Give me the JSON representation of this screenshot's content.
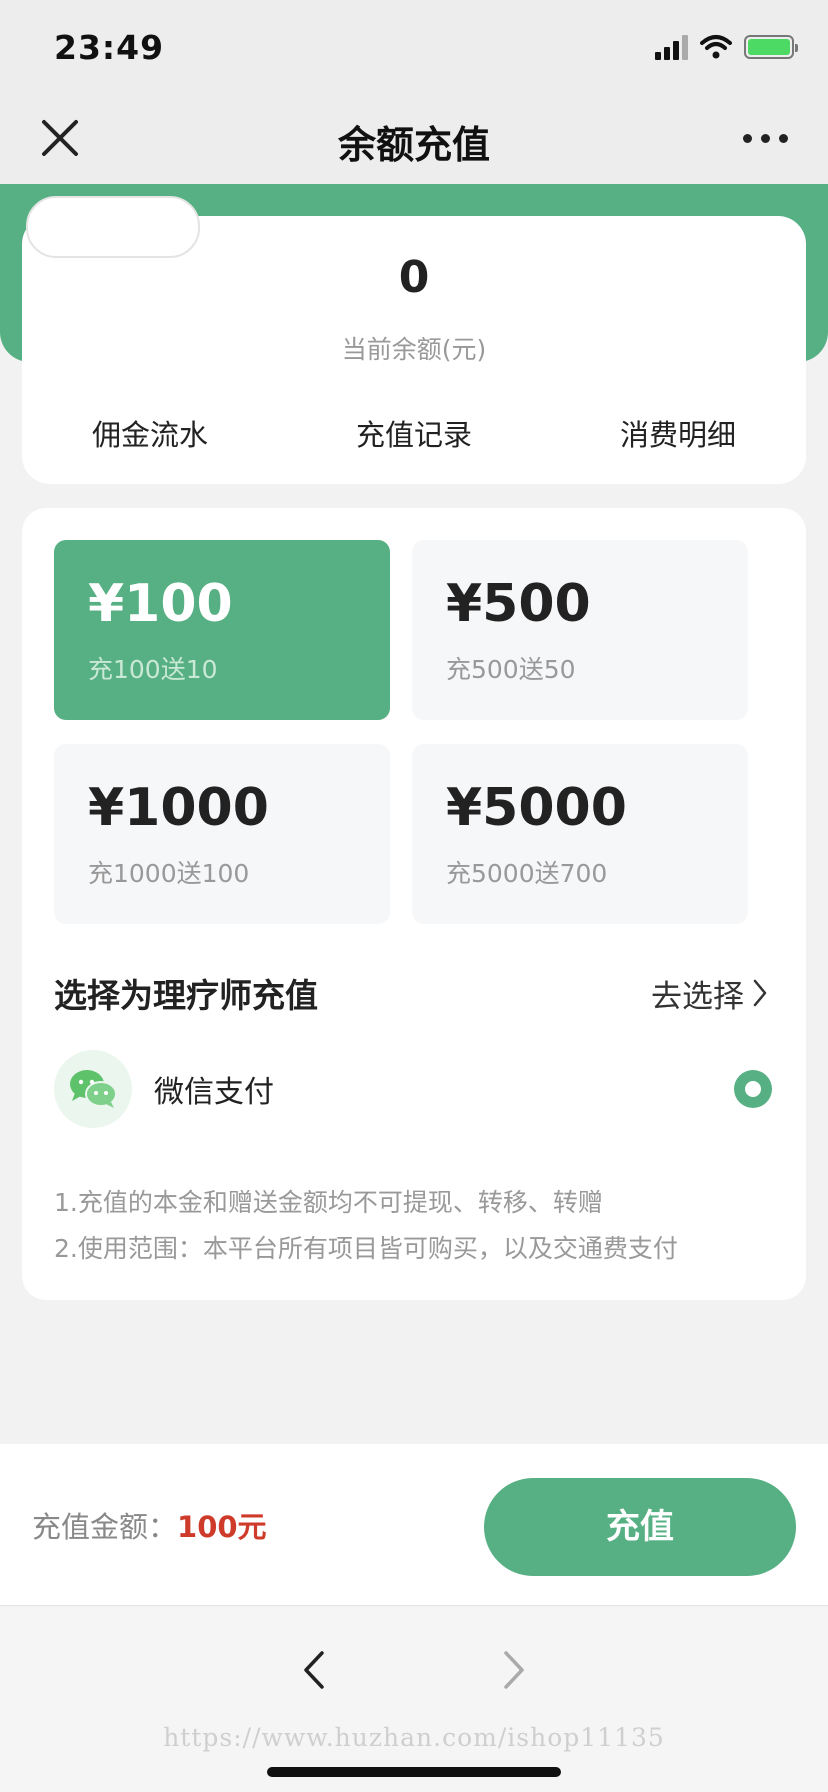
{
  "status_bar": {
    "time": "23:49"
  },
  "nav": {
    "title": "余额充值"
  },
  "balance": {
    "value": "0",
    "label": "当前余额(元)",
    "links": [
      "佣金流水",
      "充值记录",
      "消费明细"
    ]
  },
  "options": [
    {
      "amount": "¥100",
      "bonus": "充100送10",
      "selected": true
    },
    {
      "amount": "¥500",
      "bonus": "充500送50",
      "selected": false
    },
    {
      "amount": "¥1000",
      "bonus": "充1000送100",
      "selected": false
    },
    {
      "amount": "¥5000",
      "bonus": "充5000送700",
      "selected": false
    }
  ],
  "therapist": {
    "title": "选择为理疗师充值",
    "action": "去选择"
  },
  "payment": {
    "label": "微信支付",
    "selected": true
  },
  "notes": [
    "1.充值的本金和赠送金额均不可提现、转移、转赠",
    "2.使用范围：本平台所有项目皆可购买，以及交通费支付"
  ],
  "footer": {
    "amount_label": "充值金额：",
    "amount_value": "100元",
    "button_label": "充值"
  },
  "watermark": "https://www.huzhan.com/ishop11135",
  "colors": {
    "accent": "#56b083",
    "price": "#cf3b2b"
  }
}
